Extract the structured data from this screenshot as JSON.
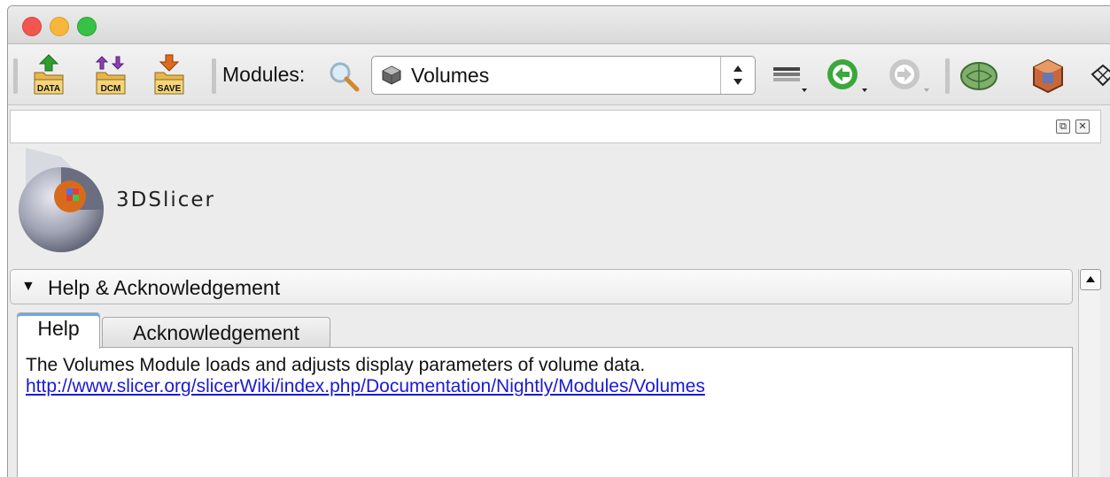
{
  "toolbar": {
    "load_data_label": "DATA",
    "load_dicom_label": "DCM",
    "save_label": "SAVE",
    "modules_label": "Modules:",
    "module_selected": "Volumes"
  },
  "logo": {
    "text": "3DSlicer"
  },
  "section": {
    "title": "Help & Acknowledgement"
  },
  "tabs": [
    {
      "label": "Help"
    },
    {
      "label": "Acknowledgement"
    }
  ],
  "help": {
    "description": "The Volumes Module loads and adjusts display parameters of volume data.",
    "link": "http://www.slicer.org/slicerWiki/index.php/Documentation/Nightly/Modules/Volumes"
  },
  "colors": {
    "link": "#1a1ad6",
    "traffic_red": "#f2564e",
    "traffic_yellow": "#f6b73a",
    "traffic_green": "#37c146",
    "back_arrow": "#3aa83a"
  }
}
